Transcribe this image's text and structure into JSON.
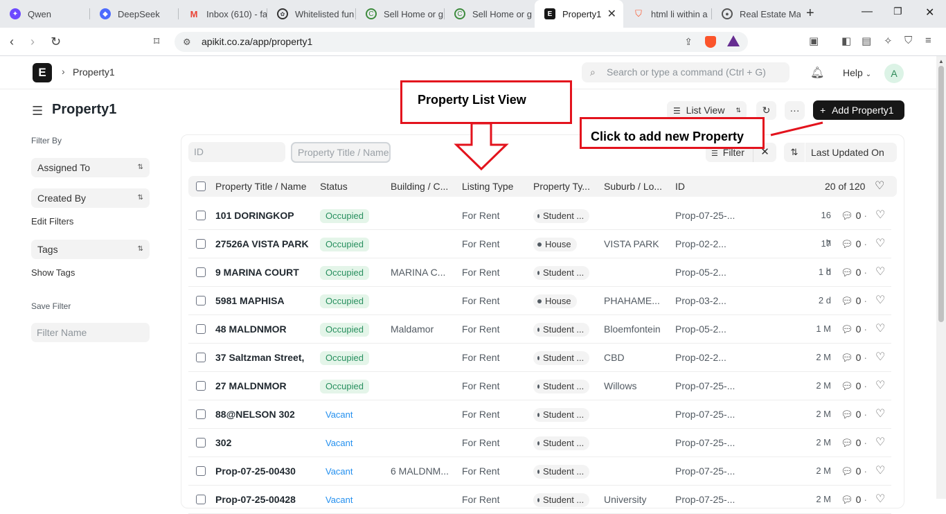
{
  "browser": {
    "tabs": [
      {
        "label": "Qwen",
        "icon": "qwen-icon"
      },
      {
        "label": "DeepSeek",
        "icon": "deepseek-icon"
      },
      {
        "label": "Inbox (610) - fa",
        "icon": "gmail-icon"
      },
      {
        "label": "Whitelisted fun",
        "icon": "openai-icon"
      },
      {
        "label": "Sell Home or g",
        "icon": "globe-icon"
      },
      {
        "label": "Sell Home or g",
        "icon": "globe-icon"
      },
      {
        "label": "Property1",
        "icon": "frappe-icon",
        "active": true
      },
      {
        "label": "html li within a",
        "icon": "brave-icon"
      },
      {
        "label": "Real Estate Ma",
        "icon": "globe-icon"
      }
    ],
    "url": "apikit.co.za/app/property1"
  },
  "app": {
    "logo_letter": "E",
    "breadcrumb": "Property1",
    "search_placeholder": "Search or type a command (Ctrl + G)",
    "help_label": "Help",
    "avatar_letter": "A"
  },
  "page": {
    "title": "Property1",
    "view_label": "List View",
    "add_button": "Add Property1"
  },
  "sidebar": {
    "filter_by": "Filter By",
    "assigned_to": "Assigned To",
    "created_by": "Created By",
    "edit_filters": "Edit Filters",
    "tags": "Tags",
    "show_tags": "Show Tags",
    "save_filter": "Save Filter",
    "filter_name_placeholder": "Filter Name"
  },
  "filters": {
    "id_placeholder": "ID",
    "title_placeholder": "Property Title / Name",
    "filter_label": "Filter",
    "sort_label": "Last Updated On"
  },
  "table": {
    "columns": [
      "Property Title / Name",
      "Status",
      "Building / C...",
      "Listing Type",
      "Property Ty...",
      "Suburb / Lo...",
      "ID"
    ],
    "count": "20 of 120",
    "rows": [
      {
        "title": "101 DORINGKOP",
        "status": "Occupied",
        "building": "",
        "listing": "For Rent",
        "ptype": "Student ...",
        "dot": false,
        "suburb": "",
        "id": "Prop-07-25-...",
        "age": "16 h",
        "comments": "0"
      },
      {
        "title": "27526A VISTA PARK",
        "status": "Occupied",
        "building": "",
        "listing": "For Rent",
        "ptype": "House",
        "dot": true,
        "suburb": "VISTA PARK",
        "id": "Prop-02-2...",
        "age": "17 h",
        "comments": "0"
      },
      {
        "title": "9 MARINA COURT",
        "status": "Occupied",
        "building": "MARINA C...",
        "listing": "For Rent",
        "ptype": "Student ...",
        "dot": false,
        "suburb": "",
        "id": "Prop-05-2...",
        "age": "1 d",
        "comments": "0"
      },
      {
        "title": "5981 MAPHISA",
        "status": "Occupied",
        "building": "",
        "listing": "For Rent",
        "ptype": "House",
        "dot": true,
        "suburb": "PHAHAME...",
        "id": "Prop-03-2...",
        "age": "2 d",
        "comments": "0"
      },
      {
        "title": "48 MALDNMOR",
        "status": "Occupied",
        "building": "Maldamor",
        "listing": "For Rent",
        "ptype": "Student ...",
        "dot": false,
        "suburb": "Bloemfontein",
        "id": "Prop-05-2...",
        "age": "1 M",
        "comments": "0"
      },
      {
        "title": "37 Saltzman Street,",
        "status": "Occupied",
        "building": "",
        "listing": "For Rent",
        "ptype": "Student ...",
        "dot": false,
        "suburb": "CBD",
        "id": "Prop-02-2...",
        "age": "2 M",
        "comments": "0"
      },
      {
        "title": "27 MALDNMOR",
        "status": "Occupied",
        "building": "",
        "listing": "For Rent",
        "ptype": "Student ...",
        "dot": false,
        "suburb": "Willows",
        "id": "Prop-07-25-...",
        "age": "2 M",
        "comments": "0"
      },
      {
        "title": "88@NELSON 302",
        "status": "Vacant",
        "building": "",
        "listing": "For Rent",
        "ptype": "Student ...",
        "dot": false,
        "suburb": "",
        "id": "Prop-07-25-...",
        "age": "2 M",
        "comments": "0"
      },
      {
        "title": "302",
        "status": "Vacant",
        "building": "",
        "listing": "For Rent",
        "ptype": "Student ...",
        "dot": false,
        "suburb": "",
        "id": "Prop-07-25-...",
        "age": "2 M",
        "comments": "0"
      },
      {
        "title": "Prop-07-25-00430",
        "status": "Vacant",
        "building": "6 MALDNM...",
        "listing": "For Rent",
        "ptype": "Student ...",
        "dot": false,
        "suburb": "",
        "id": "Prop-07-25-...",
        "age": "2 M",
        "comments": "0"
      },
      {
        "title": "Prop-07-25-00428",
        "status": "Vacant",
        "building": "",
        "listing": "For Rent",
        "ptype": "Student ...",
        "dot": false,
        "suburb": "University",
        "id": "Prop-07-25-...",
        "age": "2 M",
        "comments": "0"
      }
    ]
  },
  "annotations": {
    "list_view": "Property List View",
    "add_new": "Click to add new Property"
  },
  "colors": {
    "annotation_red": "#e3131d",
    "occupied_green": "#278f5e",
    "vacant_blue": "#2490ef"
  }
}
